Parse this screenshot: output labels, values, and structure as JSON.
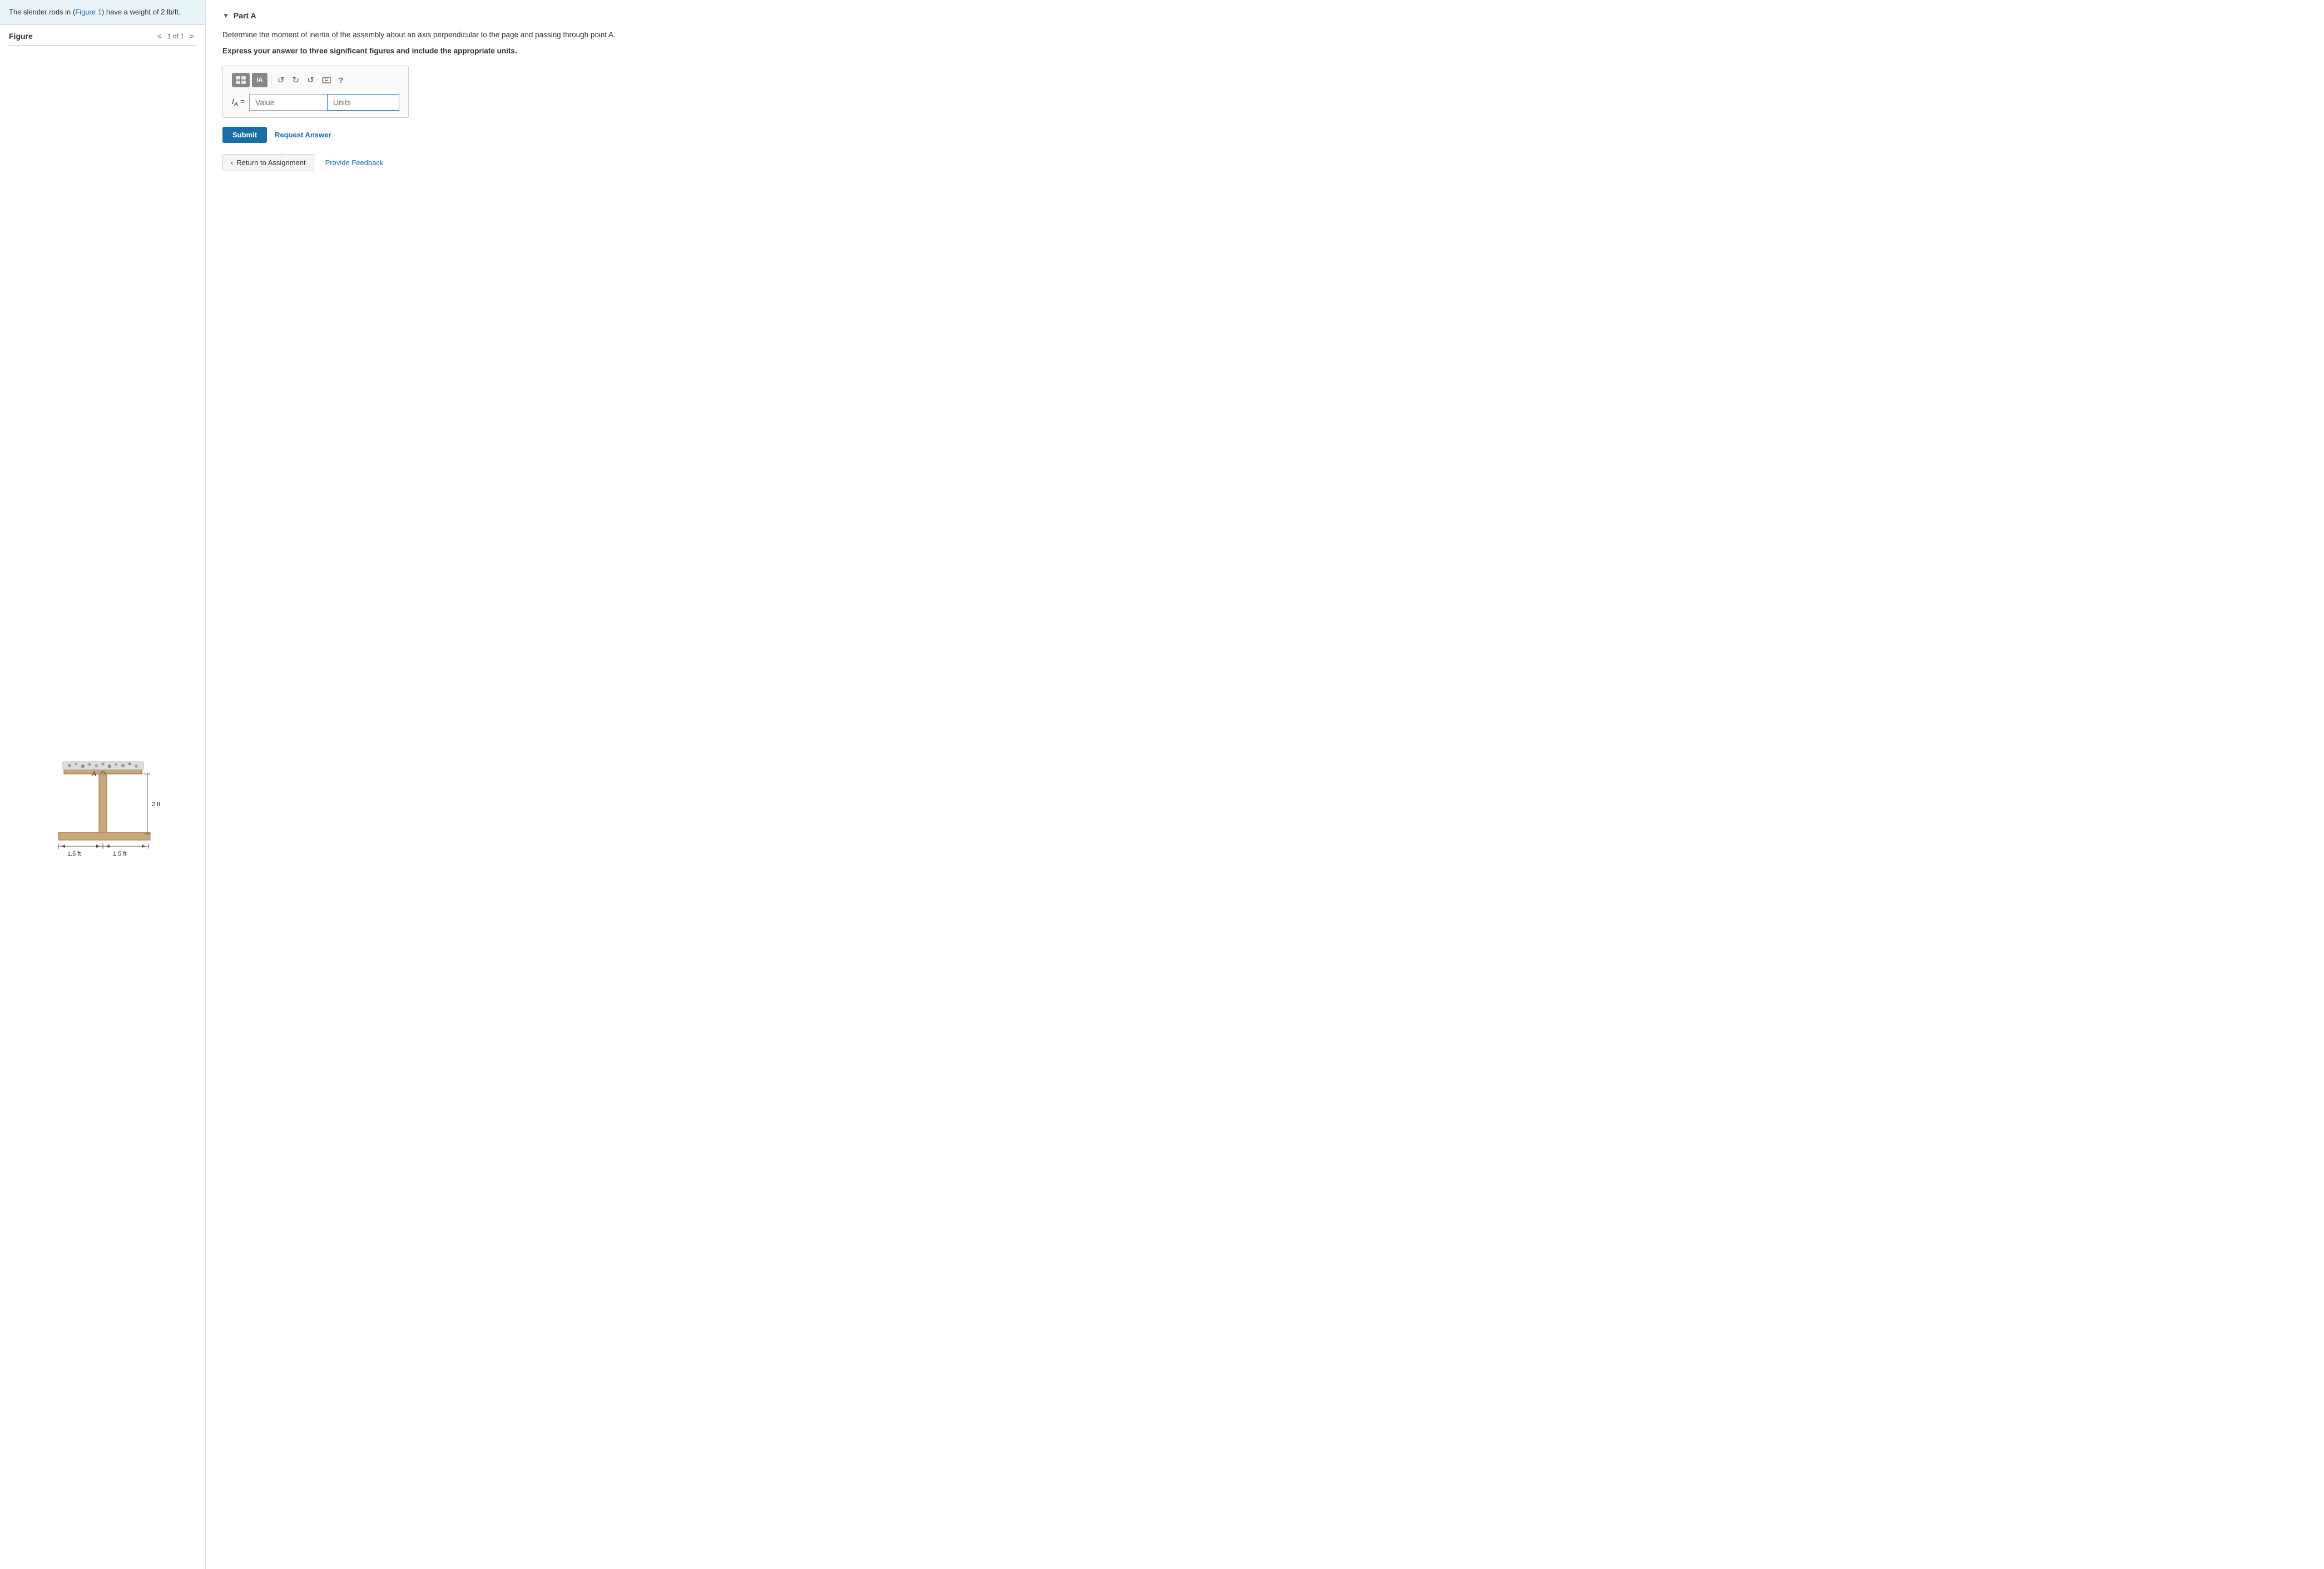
{
  "left": {
    "problem_statement": "The slender rods in (Figure 1) have a weight of 2 lb/ft.",
    "figure_link_text": "Figure 1",
    "figure_title": "Figure",
    "figure_nav": {
      "prev_label": "<",
      "page_label": "1 of 1",
      "next_label": ">"
    }
  },
  "right": {
    "part_label": "Part A",
    "question": "Determine the moment of inertia of the assembly about an axis perpendicular to the page and passing through point A.",
    "express_instruction": "Express your answer to three significant figures and include the appropriate units.",
    "toolbar": {
      "btn1_label": "⊞",
      "btn2_label": "IA",
      "undo_label": "↺",
      "redo_label": "↻",
      "reset_label": "↩",
      "keyboard_label": "⌨",
      "help_label": "?"
    },
    "input_label": "I⁁ =",
    "value_placeholder": "Value",
    "units_placeholder": "Units",
    "submit_label": "Submit",
    "request_answer_label": "Request Answer",
    "return_label": "Return to Assignment",
    "provide_feedback_label": "Provide Feedback"
  },
  "figure": {
    "label_2ft": "2 ft",
    "label_1_5ft_left": "1.5 ft",
    "label_1_5ft_right": "1.5 ft",
    "point_A": "A"
  },
  "colors": {
    "accent": "#1a6ea8",
    "submit_bg": "#1a6ea8",
    "toolbar_bg": "#888888",
    "problem_bg": "#e8f4f8"
  }
}
